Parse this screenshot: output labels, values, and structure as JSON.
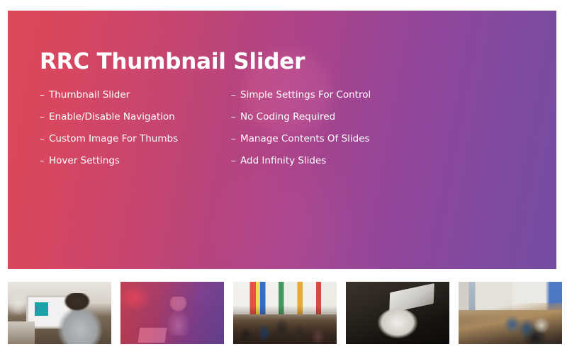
{
  "hero": {
    "title": "RRC Thumbnail Slider",
    "dash": "–",
    "features_left": [
      {
        "label": "Thumbnail Slider"
      },
      {
        "label": "Enable/Disable Navigation"
      },
      {
        "label": "Custom Image For Thumbs"
      },
      {
        "label": "Hover Settings"
      }
    ],
    "features_right": [
      {
        "label": "Simple Settings For Control"
      },
      {
        "label": "No Coding Required"
      },
      {
        "label": "Manage Contents Of Slides"
      },
      {
        "label": "Add Infinity Slides"
      }
    ],
    "gradient": {
      "start": "#ef4254",
      "mid": "#b43d8f",
      "end": "#7448ab"
    },
    "title_color": "#ffffff",
    "feature_color": "#ffffff"
  },
  "thumbnails": [
    {
      "name": "thumbnail-desk-imac",
      "art": "art-desk-imac",
      "active": false
    },
    {
      "name": "thumbnail-woman-laptop",
      "art": "art-woman-laptop",
      "active": true
    },
    {
      "name": "thumbnail-gallery-crowd",
      "art": "art-gallery-crowd",
      "active": false
    },
    {
      "name": "thumbnail-chair-laptop",
      "art": "art-chair-laptop",
      "active": false
    },
    {
      "name": "thumbnail-office-team",
      "art": "art-office-team",
      "active": false
    }
  ],
  "page": {
    "background": "#ffffff"
  }
}
